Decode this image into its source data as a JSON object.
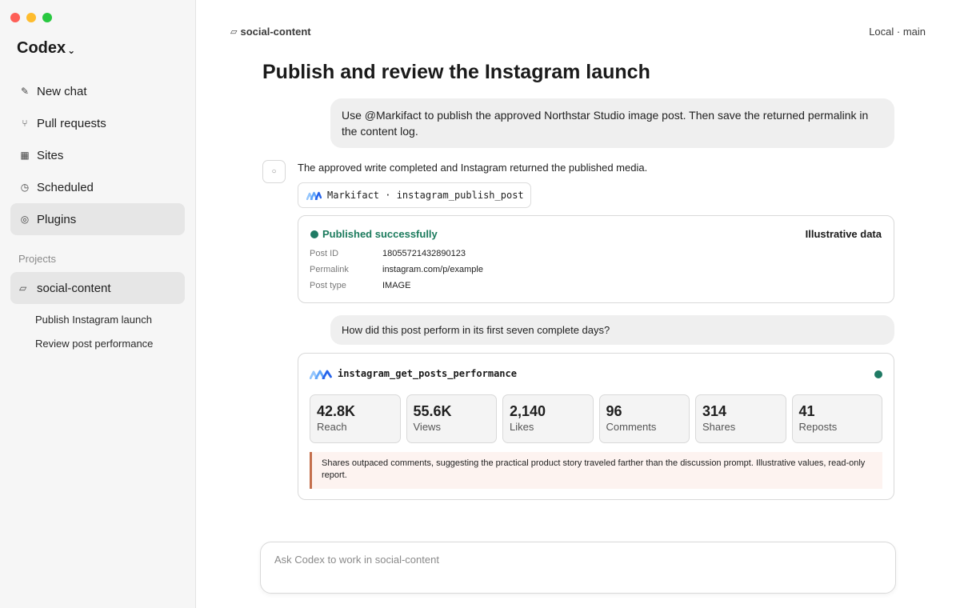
{
  "window": {
    "controls": [
      "close",
      "minimize",
      "maximize"
    ]
  },
  "sidebar": {
    "brand": "Codex",
    "brand_chevron": "⌄",
    "nav": [
      {
        "label": "New chat",
        "icon": "pencil-icon",
        "glyph": "✎"
      },
      {
        "label": "Pull requests",
        "icon": "branch-icon",
        "glyph": "⑂"
      },
      {
        "label": "Sites",
        "icon": "grid-icon",
        "glyph": "▦"
      },
      {
        "label": "Scheduled",
        "icon": "clock-icon",
        "glyph": "◷"
      },
      {
        "label": "Plugins",
        "icon": "plugin-icon",
        "glyph": "◎"
      }
    ],
    "projects_label": "Projects",
    "project": {
      "label": "social-content",
      "glyph": "▱"
    },
    "threads": [
      "Publish Instagram launch",
      "Review post performance"
    ]
  },
  "header": {
    "project": "social-content",
    "project_glyph": "▱",
    "context": "Local · main"
  },
  "conversation": {
    "title": "Publish and review the Instagram launch",
    "user_message_1": "Use @Markifact to publish the approved Northstar Studio image post. Then save the returned permalink in the content log.",
    "assistant_avatar_glyph": "○",
    "assistant_text": "The approved write completed and Instagram returned the published media.",
    "tool_call": "Markifact · instagram_publish_post",
    "publish_card": {
      "status": "Published successfully",
      "badge": "Illustrative data",
      "fields": [
        {
          "key": "Post ID",
          "value": "18055721432890123"
        },
        {
          "key": "Permalink",
          "value": "instagram.com/p/example"
        },
        {
          "key": "Post type",
          "value": "IMAGE"
        }
      ]
    },
    "user_message_2": "How did this post perform in its first seven complete days?",
    "performance_card": {
      "tool": "instagram_get_posts_performance",
      "metrics": [
        {
          "value": "42.8K",
          "label": "Reach"
        },
        {
          "value": "55.6K",
          "label": "Views"
        },
        {
          "value": "2,140",
          "label": "Likes"
        },
        {
          "value": "96",
          "label": "Comments"
        },
        {
          "value": "314",
          "label": "Shares"
        },
        {
          "value": "41",
          "label": "Reposts"
        }
      ],
      "note": "Shares outpaced comments, suggesting the practical product story traveled farther than the discussion prompt. Illustrative values, read-only report."
    }
  },
  "composer": {
    "placeholder": "Ask Codex to work in social-content"
  },
  "colors": {
    "success": "#1f7a64",
    "note_accent": "#c46f4c",
    "logo_blue": "#3b82f6"
  }
}
